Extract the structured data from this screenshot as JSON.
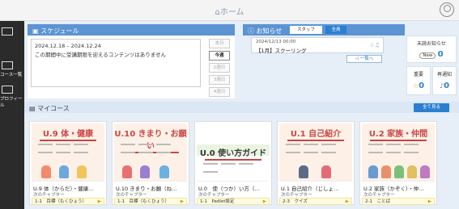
{
  "header": {
    "title": "ホーム"
  },
  "sidebar": {
    "items": [
      {
        "label": ""
      },
      {
        "label": "コース一覧"
      },
      {
        "label": "プロフィール"
      }
    ]
  },
  "schedule": {
    "title": "スケジュール",
    "date_range": "2024.12.18 – 2024.12.24",
    "message": "この期間中に受講期限を迎えるコンテンツはありません",
    "days": [
      "本日",
      "今週",
      "2週日",
      "3週日",
      "4週日"
    ]
  },
  "notice": {
    "title": "お知らせ",
    "tabs": [
      "スタッフ",
      "全員"
    ],
    "item_date": "2024/12/13 00:00",
    "item_title": "【1月】スクーリング",
    "list_link": "一覧へ",
    "unread_label": "未読お知らせ",
    "unread_badge": "New",
    "unread_count": "0",
    "important_label": "重要",
    "important_count": "0",
    "reply_label": "再通知",
    "reply_count": "0"
  },
  "courses": {
    "title": "マイコース",
    "see_all": "全て見る",
    "items": [
      {
        "thumb_title": "U.9 体・健康",
        "name": "U.9 体（からだ）・健康…",
        "next": "次のチャプター",
        "chapter": "1-1　目標（もくひょう）"
      },
      {
        "thumb_title": "U.10 きまり・お願い",
        "name": "U.10 きまり・お願（ね…",
        "next": "次のチャプター",
        "chapter": "1-1　目標（もくひょう）"
      },
      {
        "thumb_title": "U.0 使い方ガイド",
        "name": "U.0　使（つか）い方（…",
        "next": "次のチャプター",
        "chapter": "1-1　Padlet設定"
      },
      {
        "thumb_title": "U.1 自己紹介",
        "name": "U.1 自己紹介（じしょ…",
        "next": "次のチャプター",
        "chapter": "2-3　クイズ"
      },
      {
        "thumb_title": "U.2 家族・仲間",
        "name": "U.2 家族（かぞく）・仲…",
        "next": "次のチャプター",
        "chapter": "2-1　ことば"
      }
    ]
  },
  "colors": {
    "accent": "#2a7fd0",
    "header_blue": "#5b93d3",
    "background": "#e6eef7"
  }
}
